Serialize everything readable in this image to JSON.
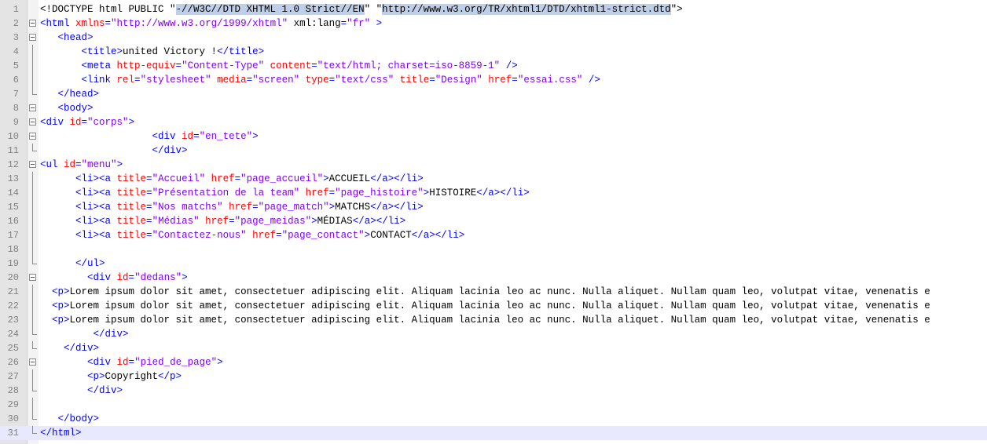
{
  "editor": {
    "colors": {
      "tag": "#0000ff",
      "attribute": "#ff0000",
      "value": "#8000ff",
      "text": "#000000",
      "selection": "#c0cfe8",
      "current_line": "#e8e8ff",
      "gutter": "#e4e4e4"
    },
    "lines": [
      {
        "n": "1",
        "fold": "none",
        "tokens": [
          {
            "t": "doc",
            "s": "<!DOCTYPE html PUBLIC \""
          },
          {
            "t": "doc",
            "s": "-//W3C//DTD XHTML 1.0 Strict//EN",
            "sel": true
          },
          {
            "t": "doc",
            "s": "\" \""
          },
          {
            "t": "doc",
            "s": "http://www.w3.org/TR/xhtml1/DTD/xhtml1-strict.dtd",
            "sel": true
          },
          {
            "t": "doc",
            "s": "\">"
          }
        ]
      },
      {
        "n": "2",
        "fold": "open",
        "tokens": [
          {
            "t": "tag",
            "s": "<html "
          },
          {
            "t": "attr",
            "s": "xmlns"
          },
          {
            "t": "tag",
            "s": "="
          },
          {
            "t": "val",
            "s": "\"http://www.w3.org/1999/xhtml\""
          },
          {
            "t": "txt",
            "s": " xml:lang"
          },
          {
            "t": "tag",
            "s": "="
          },
          {
            "t": "val",
            "s": "\"fr\""
          },
          {
            "t": "tag",
            "s": " >"
          }
        ]
      },
      {
        "n": "3",
        "fold": "open",
        "tokens": [
          {
            "t": "txt",
            "s": "   "
          },
          {
            "t": "tag",
            "s": "<head>"
          }
        ]
      },
      {
        "n": "4",
        "fold": "line",
        "tokens": [
          {
            "t": "txt",
            "s": "       "
          },
          {
            "t": "tag",
            "s": "<title>"
          },
          {
            "t": "txt",
            "s": "united Victory !"
          },
          {
            "t": "tag",
            "s": "</title>"
          }
        ]
      },
      {
        "n": "5",
        "fold": "line",
        "tokens": [
          {
            "t": "txt",
            "s": "       "
          },
          {
            "t": "tag",
            "s": "<meta "
          },
          {
            "t": "attr",
            "s": "http-equiv"
          },
          {
            "t": "tag",
            "s": "="
          },
          {
            "t": "val",
            "s": "\"Content-Type\""
          },
          {
            "t": "txt",
            "s": " "
          },
          {
            "t": "attr",
            "s": "content"
          },
          {
            "t": "tag",
            "s": "="
          },
          {
            "t": "val",
            "s": "\"text/html; charset=iso-8859-1\""
          },
          {
            "t": "tag",
            "s": " />"
          }
        ]
      },
      {
        "n": "6",
        "fold": "line",
        "tokens": [
          {
            "t": "txt",
            "s": "       "
          },
          {
            "t": "tag",
            "s": "<link "
          },
          {
            "t": "attr",
            "s": "rel"
          },
          {
            "t": "tag",
            "s": "="
          },
          {
            "t": "val",
            "s": "\"stylesheet\""
          },
          {
            "t": "txt",
            "s": " "
          },
          {
            "t": "attr",
            "s": "media"
          },
          {
            "t": "tag",
            "s": "="
          },
          {
            "t": "val",
            "s": "\"screen\""
          },
          {
            "t": "txt",
            "s": " "
          },
          {
            "t": "attr",
            "s": "type"
          },
          {
            "t": "tag",
            "s": "="
          },
          {
            "t": "val",
            "s": "\"text/css\""
          },
          {
            "t": "txt",
            "s": " "
          },
          {
            "t": "attr",
            "s": "title"
          },
          {
            "t": "tag",
            "s": "="
          },
          {
            "t": "val",
            "s": "\"Design\""
          },
          {
            "t": "txt",
            "s": " "
          },
          {
            "t": "attr",
            "s": "href"
          },
          {
            "t": "tag",
            "s": "="
          },
          {
            "t": "val",
            "s": "\"essai.css\""
          },
          {
            "t": "tag",
            "s": " />"
          }
        ]
      },
      {
        "n": "7",
        "fold": "end",
        "tokens": [
          {
            "t": "txt",
            "s": "   "
          },
          {
            "t": "tag",
            "s": "</head>"
          }
        ]
      },
      {
        "n": "8",
        "fold": "open",
        "tokens": [
          {
            "t": "txt",
            "s": "   "
          },
          {
            "t": "tag",
            "s": "<body>"
          }
        ]
      },
      {
        "n": "9",
        "fold": "open",
        "tokens": [
          {
            "t": "tag",
            "s": "<div "
          },
          {
            "t": "attr",
            "s": "id"
          },
          {
            "t": "tag",
            "s": "="
          },
          {
            "t": "val",
            "s": "\"corps\""
          },
          {
            "t": "tag",
            "s": ">"
          }
        ]
      },
      {
        "n": "10",
        "fold": "open",
        "tokens": [
          {
            "t": "txt",
            "s": "                   "
          },
          {
            "t": "tag",
            "s": "<div "
          },
          {
            "t": "attr",
            "s": "id"
          },
          {
            "t": "tag",
            "s": "="
          },
          {
            "t": "val",
            "s": "\"en_tete\""
          },
          {
            "t": "tag",
            "s": ">"
          }
        ]
      },
      {
        "n": "11",
        "fold": "end",
        "tokens": [
          {
            "t": "txt",
            "s": "                   "
          },
          {
            "t": "tag",
            "s": "</div>"
          }
        ]
      },
      {
        "n": "12",
        "fold": "open",
        "tokens": [
          {
            "t": "tag",
            "s": "<ul "
          },
          {
            "t": "attr",
            "s": "id"
          },
          {
            "t": "tag",
            "s": "="
          },
          {
            "t": "val",
            "s": "\"menu\""
          },
          {
            "t": "tag",
            "s": ">"
          }
        ]
      },
      {
        "n": "13",
        "fold": "line",
        "tokens": [
          {
            "t": "txt",
            "s": "      "
          },
          {
            "t": "tag",
            "s": "<li><a "
          },
          {
            "t": "attr",
            "s": "title"
          },
          {
            "t": "tag",
            "s": "="
          },
          {
            "t": "val",
            "s": "\"Accueil\""
          },
          {
            "t": "txt",
            "s": " "
          },
          {
            "t": "attr",
            "s": "href"
          },
          {
            "t": "tag",
            "s": "="
          },
          {
            "t": "val",
            "s": "\"page_accueil\""
          },
          {
            "t": "tag",
            "s": ">"
          },
          {
            "t": "txt",
            "s": "ACCUEIL"
          },
          {
            "t": "tag",
            "s": "</a></li>"
          }
        ]
      },
      {
        "n": "14",
        "fold": "line",
        "tokens": [
          {
            "t": "txt",
            "s": "      "
          },
          {
            "t": "tag",
            "s": "<li><a "
          },
          {
            "t": "attr",
            "s": "title"
          },
          {
            "t": "tag",
            "s": "="
          },
          {
            "t": "val",
            "s": "\"Présentation de la team\""
          },
          {
            "t": "txt",
            "s": " "
          },
          {
            "t": "attr",
            "s": "href"
          },
          {
            "t": "tag",
            "s": "="
          },
          {
            "t": "val",
            "s": "\"page_histoire\""
          },
          {
            "t": "tag",
            "s": ">"
          },
          {
            "t": "txt",
            "s": "HISTOIRE"
          },
          {
            "t": "tag",
            "s": "</a></li>"
          }
        ]
      },
      {
        "n": "15",
        "fold": "line",
        "tokens": [
          {
            "t": "txt",
            "s": "      "
          },
          {
            "t": "tag",
            "s": "<li><a "
          },
          {
            "t": "attr",
            "s": "title"
          },
          {
            "t": "tag",
            "s": "="
          },
          {
            "t": "val",
            "s": "\"Nos matchs\""
          },
          {
            "t": "txt",
            "s": " "
          },
          {
            "t": "attr",
            "s": "href"
          },
          {
            "t": "tag",
            "s": "="
          },
          {
            "t": "val",
            "s": "\"page_match\""
          },
          {
            "t": "tag",
            "s": ">"
          },
          {
            "t": "txt",
            "s": "MATCHS"
          },
          {
            "t": "tag",
            "s": "</a></li>"
          }
        ]
      },
      {
        "n": "16",
        "fold": "line",
        "tokens": [
          {
            "t": "txt",
            "s": "      "
          },
          {
            "t": "tag",
            "s": "<li><a "
          },
          {
            "t": "attr",
            "s": "title"
          },
          {
            "t": "tag",
            "s": "="
          },
          {
            "t": "val",
            "s": "\"Médias\""
          },
          {
            "t": "txt",
            "s": " "
          },
          {
            "t": "attr",
            "s": "href"
          },
          {
            "t": "tag",
            "s": "="
          },
          {
            "t": "val",
            "s": "\"page_meidas\""
          },
          {
            "t": "tag",
            "s": ">"
          },
          {
            "t": "txt",
            "s": "MÉDIAS"
          },
          {
            "t": "tag",
            "s": "</a></li>"
          }
        ]
      },
      {
        "n": "17",
        "fold": "line",
        "tokens": [
          {
            "t": "txt",
            "s": "      "
          },
          {
            "t": "tag",
            "s": "<li><a "
          },
          {
            "t": "attr",
            "s": "title"
          },
          {
            "t": "tag",
            "s": "="
          },
          {
            "t": "val",
            "s": "\"Contactez-nous\""
          },
          {
            "t": "txt",
            "s": " "
          },
          {
            "t": "attr",
            "s": "href"
          },
          {
            "t": "tag",
            "s": "="
          },
          {
            "t": "val",
            "s": "\"page_contact\""
          },
          {
            "t": "tag",
            "s": ">"
          },
          {
            "t": "txt",
            "s": "CONTACT"
          },
          {
            "t": "tag",
            "s": "</a></li>"
          }
        ]
      },
      {
        "n": "18",
        "fold": "line",
        "tokens": []
      },
      {
        "n": "19",
        "fold": "end",
        "tokens": [
          {
            "t": "txt",
            "s": "      "
          },
          {
            "t": "tag",
            "s": "</ul>"
          }
        ]
      },
      {
        "n": "20",
        "fold": "open",
        "tokens": [
          {
            "t": "txt",
            "s": "        "
          },
          {
            "t": "tag",
            "s": "<div "
          },
          {
            "t": "attr",
            "s": "id"
          },
          {
            "t": "tag",
            "s": "="
          },
          {
            "t": "val",
            "s": "\"dedans\""
          },
          {
            "t": "tag",
            "s": ">"
          }
        ]
      },
      {
        "n": "21",
        "fold": "line",
        "tokens": [
          {
            "t": "txt",
            "s": "  "
          },
          {
            "t": "tag",
            "s": "<p>"
          },
          {
            "t": "txt",
            "s": "Lorem ipsum dolor sit amet, consectetuer adipiscing elit. Aliquam lacinia leo ac nunc. Nulla aliquet. Nullam quam leo, volutpat vitae, venenatis e"
          }
        ]
      },
      {
        "n": "22",
        "fold": "line",
        "tokens": [
          {
            "t": "txt",
            "s": "  "
          },
          {
            "t": "tag",
            "s": "<p>"
          },
          {
            "t": "txt",
            "s": "Lorem ipsum dolor sit amet, consectetuer adipiscing elit. Aliquam lacinia leo ac nunc. Nulla aliquet. Nullam quam leo, volutpat vitae, venenatis e"
          }
        ]
      },
      {
        "n": "23",
        "fold": "line",
        "tokens": [
          {
            "t": "txt",
            "s": "  "
          },
          {
            "t": "tag",
            "s": "<p>"
          },
          {
            "t": "txt",
            "s": "Lorem ipsum dolor sit amet, consectetuer adipiscing elit. Aliquam lacinia leo ac nunc. Nulla aliquet. Nullam quam leo, volutpat vitae, venenatis e"
          }
        ]
      },
      {
        "n": "24",
        "fold": "end",
        "tokens": [
          {
            "t": "txt",
            "s": "         "
          },
          {
            "t": "tag",
            "s": "</div>"
          }
        ]
      },
      {
        "n": "25",
        "fold": "end",
        "tokens": [
          {
            "t": "txt",
            "s": "    "
          },
          {
            "t": "tag",
            "s": "</div>"
          }
        ]
      },
      {
        "n": "26",
        "fold": "open",
        "tokens": [
          {
            "t": "txt",
            "s": "        "
          },
          {
            "t": "tag",
            "s": "<div "
          },
          {
            "t": "attr",
            "s": "id"
          },
          {
            "t": "tag",
            "s": "="
          },
          {
            "t": "val",
            "s": "\"pied_de_page\""
          },
          {
            "t": "tag",
            "s": ">"
          }
        ]
      },
      {
        "n": "27",
        "fold": "line",
        "tokens": [
          {
            "t": "txt",
            "s": "        "
          },
          {
            "t": "tag",
            "s": "<p>"
          },
          {
            "t": "txt",
            "s": "Copyright"
          },
          {
            "t": "tag",
            "s": "</p>"
          }
        ]
      },
      {
        "n": "28",
        "fold": "end",
        "tokens": [
          {
            "t": "txt",
            "s": "        "
          },
          {
            "t": "tag",
            "s": "</div>"
          }
        ]
      },
      {
        "n": "29",
        "fold": "line",
        "tokens": []
      },
      {
        "n": "30",
        "fold": "end",
        "tokens": [
          {
            "t": "txt",
            "s": "   "
          },
          {
            "t": "tag",
            "s": "</body>"
          }
        ]
      },
      {
        "n": "31",
        "fold": "end",
        "current": true,
        "tokens": [
          {
            "t": "tag",
            "s": "</html>"
          }
        ]
      }
    ]
  }
}
